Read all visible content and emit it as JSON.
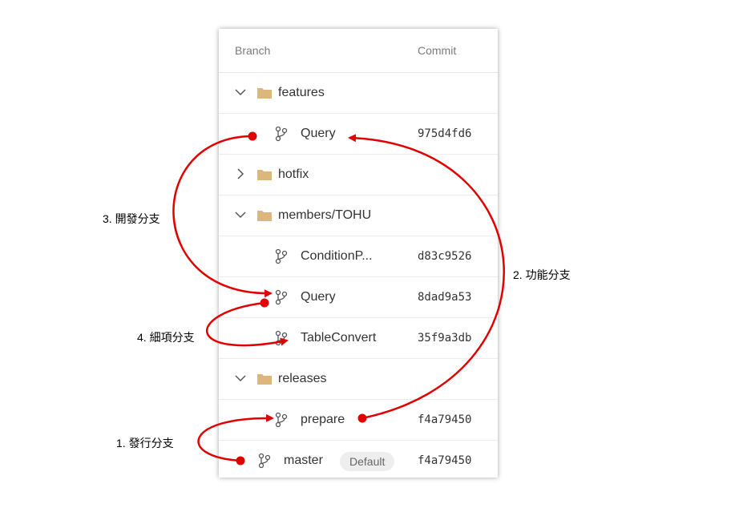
{
  "header": {
    "branch": "Branch",
    "commit": "Commit"
  },
  "rows": [
    {
      "type": "folder",
      "name": "features",
      "expanded": true
    },
    {
      "type": "branch",
      "name": "Query",
      "commit": "975d4fd6"
    },
    {
      "type": "folder",
      "name": "hotfix",
      "expanded": false
    },
    {
      "type": "folder",
      "name": "members/TOHU",
      "expanded": true
    },
    {
      "type": "branch",
      "name": "ConditionP...",
      "commit": "d83c9526"
    },
    {
      "type": "branch",
      "name": "Query",
      "commit": "8dad9a53"
    },
    {
      "type": "branch",
      "name": "TableConvert",
      "commit": "35f9a3db"
    },
    {
      "type": "folder",
      "name": "releases",
      "expanded": true
    },
    {
      "type": "branch",
      "name": "prepare",
      "commit": "f4a79450"
    },
    {
      "type": "branch",
      "name": "master",
      "commit": "f4a79450",
      "badge": "Default"
    }
  ],
  "annotations": {
    "release": "1. 發行分支",
    "feature": "2. 功能分支",
    "develop": "3. 開發分支",
    "detail": "4. 細項分支"
  },
  "colors": {
    "arrow": "#e00000",
    "folder": "#dcb67a"
  }
}
